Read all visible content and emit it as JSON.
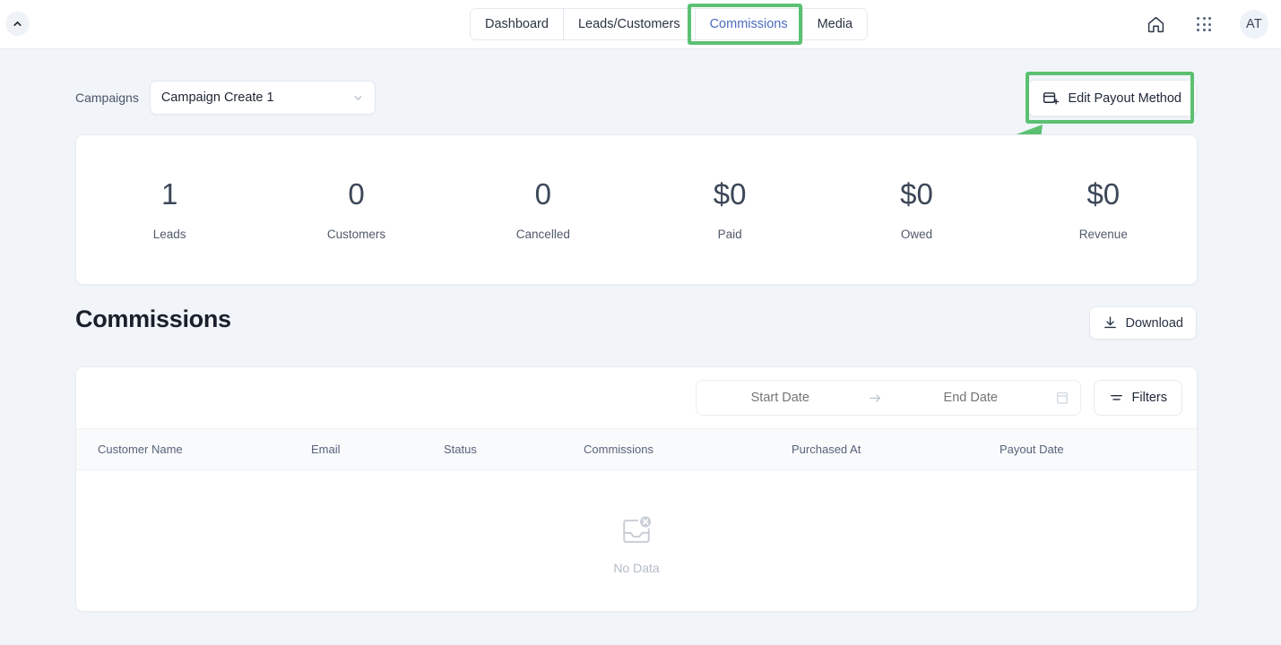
{
  "topbar": {
    "collapse_button": "collapse-sidebar",
    "tabs": [
      {
        "label": "Dashboard",
        "active": false
      },
      {
        "label": "Leads/Customers",
        "active": false
      },
      {
        "label": "Commissions",
        "active": true
      },
      {
        "label": "Media",
        "active": false
      }
    ],
    "icons": {
      "home": "home-icon",
      "apps": "apps-grid-icon"
    },
    "avatar_initials": "AT"
  },
  "filters": {
    "campaigns_label": "Campaigns",
    "campaign_selected": "Campaign Create 1",
    "edit_payout_label": "Edit Payout Method"
  },
  "stats": [
    {
      "value": "1",
      "label": "Leads"
    },
    {
      "value": "0",
      "label": "Customers"
    },
    {
      "value": "0",
      "label": "Cancelled"
    },
    {
      "value": "$0",
      "label": "Paid"
    },
    {
      "value": "$0",
      "label": "Owed"
    },
    {
      "value": "$0",
      "label": "Revenue"
    }
  ],
  "section": {
    "title": "Commissions",
    "download_label": "Download"
  },
  "table": {
    "start_date_placeholder": "Start Date",
    "end_date_placeholder": "End Date",
    "filters_label": "Filters",
    "columns": [
      "Customer Name",
      "Email",
      "Status",
      "Commissions",
      "Purchased At",
      "Payout Date"
    ],
    "rows": [],
    "empty_text": "No Data"
  },
  "annotations": {
    "highlight_color": "#5cc072",
    "highlighted_tab": "Commissions",
    "highlighted_button": "Edit Payout Method",
    "arrow": "green-arrow-pointing-to-edit-payout-method"
  }
}
